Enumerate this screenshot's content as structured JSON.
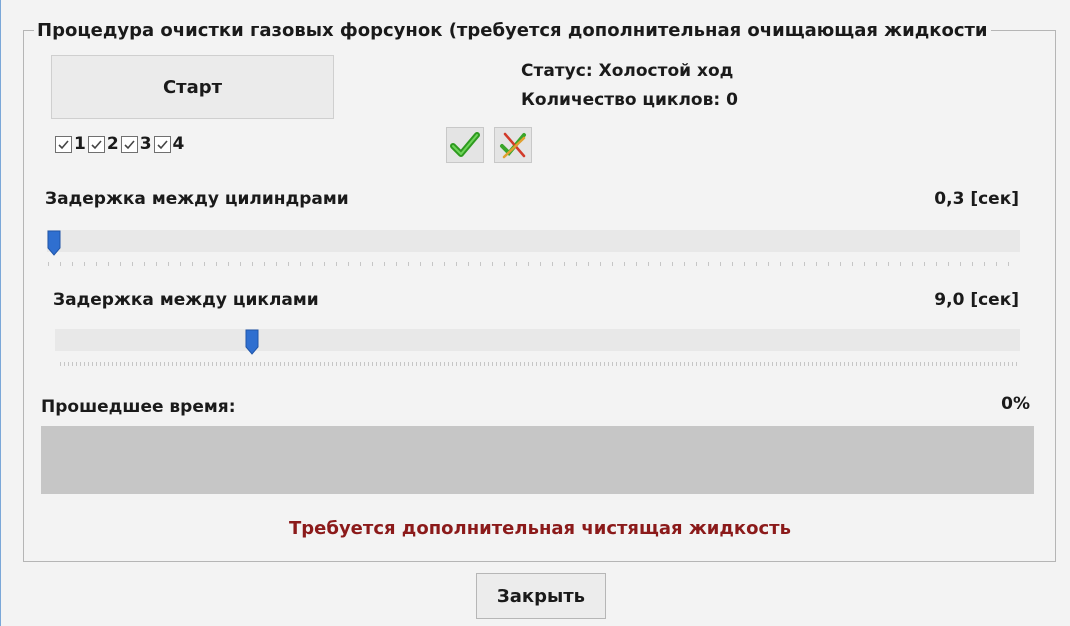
{
  "group": {
    "title": "Процедура очистки газовых форсунок (требуется дополнительная очищающая жидкости"
  },
  "start_button": {
    "label": "Старт"
  },
  "status": {
    "status_label": "Статус:",
    "status_value": "Холостой ход",
    "cycles_label": "Количество циклов:",
    "cycles_value": "0"
  },
  "cylinders": [
    {
      "label": "1",
      "checked": true
    },
    {
      "label": "2",
      "checked": true
    },
    {
      "label": "3",
      "checked": true
    },
    {
      "label": "4",
      "checked": true
    }
  ],
  "icons": {
    "select_all": "check-all-icon",
    "clear_all": "uncheck-all-icon"
  },
  "cylinder_delay": {
    "label": "Задержка между цилиндрами",
    "value_text": "0,3 [сек]",
    "level": 0.0
  },
  "cycle_delay": {
    "label": "Задержка между циклами",
    "value_text": "9,0 [сек]",
    "level": 0.2
  },
  "elapsed": {
    "label": "Прошедшее время:",
    "percent_text": "0%",
    "progress": 0
  },
  "warning": {
    "text": "Требуется дополнительная чистящая жидкость",
    "color": "#8b1a1a"
  },
  "close_button": {
    "label": "Закрыть"
  },
  "colors": {
    "accent": "#3a7bd5",
    "check_green": "#2e9a1f"
  }
}
